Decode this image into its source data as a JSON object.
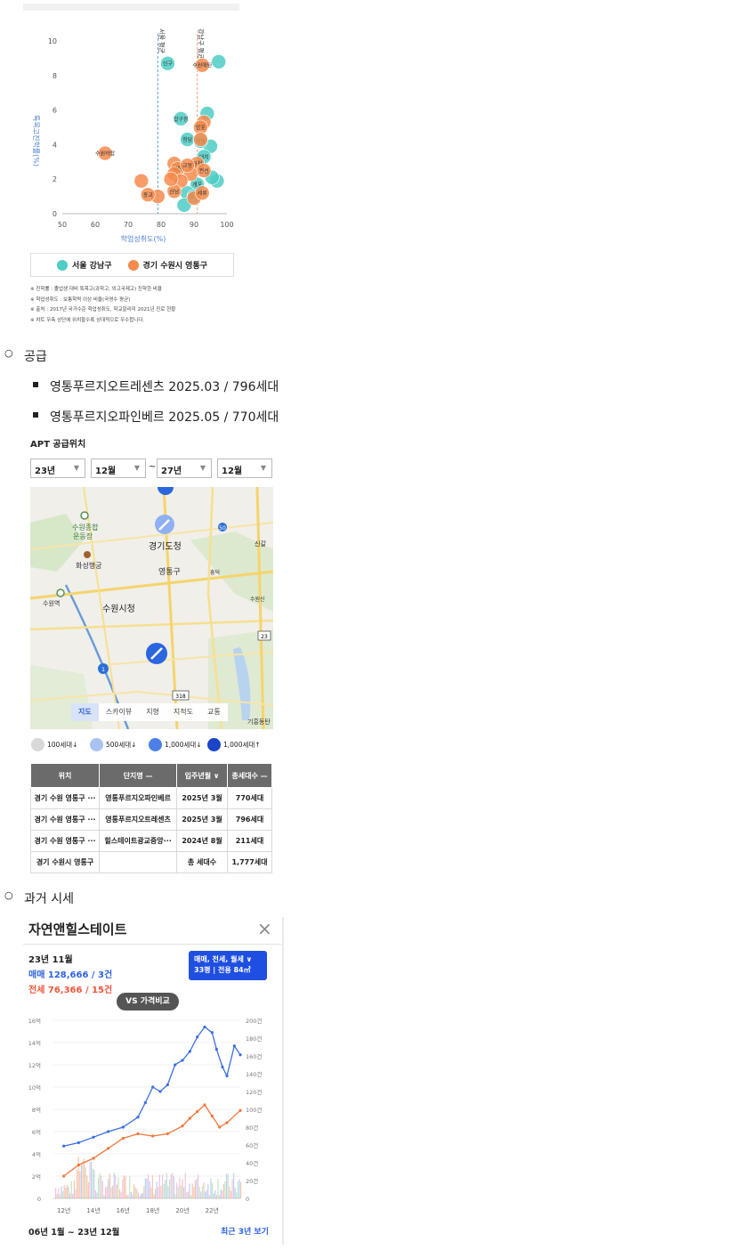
{
  "scatter": {
    "ylabel": "특목고진학률(%)",
    "xlabel": "학업성취도(%)",
    "x_ticks": [
      "50",
      "60",
      "70",
      "80",
      "90",
      "100"
    ],
    "y_ticks": [
      "0",
      "2",
      "4",
      "6",
      "8",
      "10"
    ],
    "line_labels": [
      "서울 평균",
      "강남구 평균"
    ],
    "legend": [
      "서울 강남구",
      "경기 수원시 영통구"
    ],
    "colors": {
      "gangnam": "#4ecdc4",
      "yeongtong": "#f58b4c"
    },
    "point_labels": [
      "신구",
      "압구정",
      "청담",
      "대치",
      "개포",
      "도곡",
      "매봉",
      "수원하탑",
      "수원매탄",
      "망포",
      "영통",
      "원천",
      "권선",
      "산남",
      "광교",
      "세류",
      "교동"
    ],
    "notes": [
      "※ 진학률 : 졸업생 대비 특목고(과학고, 외고국제고) 진학한 비율",
      "※ 학업성취도 : 보통학력 이상 비율(국영수 평균)",
      "※ 출처 : 2017년 국가수준 학업성취도, 학교알리미 2021년 진로 현황",
      "※ 차트 우측 상단에 위치할수록 상대적으로 우수합니다."
    ]
  },
  "chart_data": [
    {
      "type": "scatter",
      "xlabel": "학업성취도(%)",
      "ylabel": "특목고진학률(%)",
      "xlim": [
        50,
        100
      ],
      "ylim": [
        0,
        10
      ],
      "reference_lines": [
        {
          "label": "서울 평균",
          "x": 79
        },
        {
          "label": "강남구 평균",
          "x": 91
        }
      ],
      "series": [
        {
          "name": "서울 강남구",
          "points": [
            [
              82,
              8.7
            ],
            [
              97.5,
              8.8
            ],
            [
              86,
              5.5
            ],
            [
              94,
              5.8
            ],
            [
              88,
              4.3
            ],
            [
              95,
              3.9
            ],
            [
              93,
              3.3
            ],
            [
              97,
              1.9
            ],
            [
              91,
              1.7
            ],
            [
              88,
              1.2
            ],
            [
              90,
              1.0
            ],
            [
              87,
              0.5
            ],
            [
              92,
              4.2
            ],
            [
              95.5,
              2.1
            ]
          ]
        },
        {
          "name": "경기 수원시 영통구",
          "points": [
            [
              63,
              3.5
            ],
            [
              74,
              1.9
            ],
            [
              92.5,
              8.6
            ],
            [
              93,
              5.3
            ],
            [
              92,
              5.0
            ],
            [
              84,
              2.9
            ],
            [
              85,
              2.6
            ],
            [
              84,
              2.3
            ],
            [
              91,
              2.9
            ],
            [
              89,
              2.3
            ],
            [
              93,
              2.5
            ],
            [
              86,
              1.9
            ],
            [
              84,
              1.3
            ],
            [
              79,
              1.0
            ],
            [
              76,
              1.1
            ],
            [
              90,
              0.9
            ],
            [
              92.5,
              1.2
            ],
            [
              92,
              4.3
            ],
            [
              88,
              2.8
            ],
            [
              83,
              2.0
            ]
          ]
        }
      ]
    },
    {
      "type": "line",
      "title": "",
      "x_ticks": [
        "12년",
        "14년",
        "16년",
        "18년",
        "20년",
        "22년"
      ],
      "y_left_ticks": [
        "0",
        "2억",
        "4억",
        "6억",
        "8억",
        "10억",
        "12억",
        "14억",
        "16억"
      ],
      "y_right_ticks": [
        "0",
        "20건",
        "40건",
        "60건",
        "80건",
        "100건",
        "120건",
        "140건",
        "160건",
        "180건",
        "200건"
      ],
      "ylim_left": [
        0,
        16
      ],
      "ylim_right": [
        0,
        200
      ],
      "series": [
        {
          "name": "매매",
          "color": "#3b6fe0",
          "x": [
            2012,
            2013,
            2014,
            2015,
            2016,
            2017,
            2017.5,
            2018,
            2018.5,
            2019,
            2019.5,
            2020,
            2020.5,
            2021,
            2021.5,
            2022,
            2022.3,
            2022.7,
            2023,
            2023.5,
            2023.9
          ],
          "values": [
            4.7,
            5.0,
            5.5,
            6.0,
            6.4,
            7.3,
            8.6,
            10.0,
            9.6,
            10.2,
            12.0,
            12.4,
            13.2,
            14.5,
            15.4,
            14.9,
            13.4,
            11.8,
            11.0,
            13.7,
            12.9
          ]
        },
        {
          "name": "전세",
          "color": "#f0773a",
          "x": [
            2012,
            2013,
            2014,
            2015,
            2016,
            2017,
            2018,
            2019,
            2020,
            2020.5,
            2021,
            2021.5,
            2022,
            2022.5,
            2023,
            2023.9
          ],
          "values": [
            2.0,
            3.0,
            3.6,
            4.5,
            5.4,
            5.8,
            5.6,
            5.8,
            6.5,
            7.2,
            7.8,
            8.4,
            7.4,
            6.4,
            6.8,
            7.9
          ]
        }
      ]
    }
  ],
  "supply": {
    "heading": "공급",
    "items": [
      "영통푸르지오트레센츠 2025.03 / 796세대",
      "영통푸르지오파인베르 2025.05 / 770세대"
    ]
  },
  "apt": {
    "title": "APT 공급위치",
    "selects": [
      "23년",
      "12월",
      "27년",
      "12월"
    ],
    "tilde": "~",
    "map_labels": [
      "수원종합",
      "운동장",
      "경기도청",
      "화성행궁",
      "영통구",
      "수원시청",
      "수원역",
      "신갈",
      "흥덕",
      "수원신",
      "기흥동탄"
    ],
    "map_tabs": [
      "지도",
      "스카이뷰",
      "지형",
      "지적도",
      "교통"
    ],
    "legend": [
      "100세대↓",
      "500세대↓",
      "1,000세대↓",
      "1,000세대↑"
    ],
    "table_headers": [
      "위치",
      "단지명 —",
      "입주년월 ∨",
      "총세대수 —"
    ],
    "rows": [
      [
        "경기 수원 영통구 ···",
        "영통푸르지오파인베르",
        "2025년 3월",
        "770세대"
      ],
      [
        "경기 수원 영통구 ···",
        "영통푸르지오트레센츠",
        "2025년 3월",
        "796세대"
      ],
      [
        "경기 수원 영통구 ···",
        "힐스테이트광교중앙···",
        "2024년 8월",
        "211세대"
      ]
    ],
    "total_row": [
      "경기 수원시 영통구",
      "",
      "총 세대수",
      "1,777세대"
    ]
  },
  "past": {
    "heading": "과거 시세",
    "title": "자연앤힐스테이트",
    "close": "×",
    "date": "23년 11월",
    "sale": "매매 128,666 / 3건",
    "rent": "전세 76,366 / 15건",
    "filter_line1": "매매, 전세, 월세 ∨",
    "filter_line2": "33평 | 전용 84㎡",
    "vs": "VS 가격비교",
    "range": "06년 1월 ~ 23년 12월",
    "recent": "최근 3년 보기"
  }
}
